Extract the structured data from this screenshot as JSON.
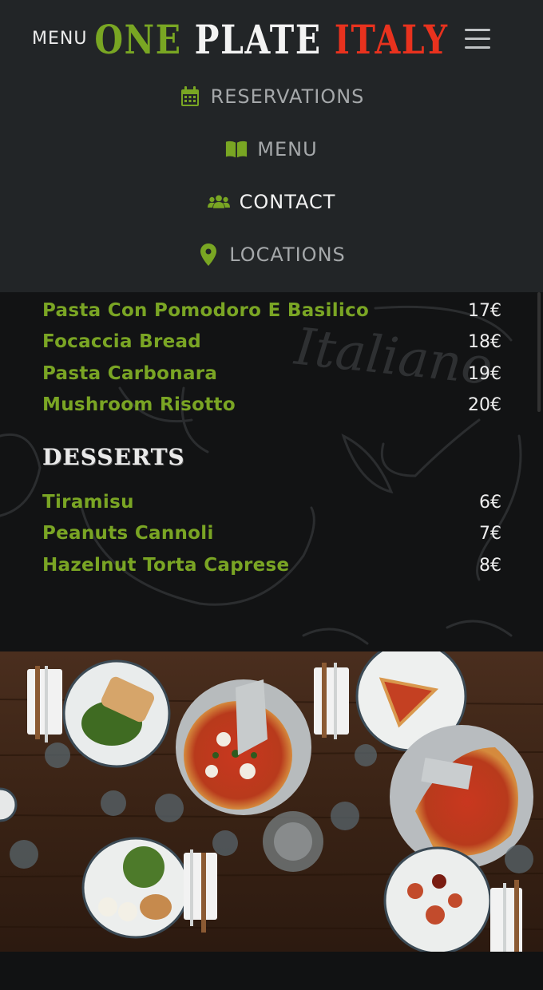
{
  "header": {
    "menu_label": "MENU",
    "logo": {
      "word1": "ONE",
      "word2": "PLATE",
      "word3": "ITALY"
    },
    "colors": {
      "green": "#79a623",
      "white": "#f3f3f3",
      "red": "#e8321e"
    }
  },
  "nav": {
    "items": [
      {
        "label": "RESERVATIONS",
        "icon": "calendar-icon"
      },
      {
        "label": "MENU",
        "icon": "book-icon"
      },
      {
        "label": "CONTACT",
        "icon": "users-icon",
        "active": true
      },
      {
        "label": "LOCATIONS",
        "icon": "map-pin-icon"
      }
    ]
  },
  "mains": [
    {
      "name": "Pasta Con Pomodoro E Basilico",
      "price": "17€"
    },
    {
      "name": "Focaccia Bread",
      "price": "18€"
    },
    {
      "name": "Pasta Carbonara",
      "price": "19€"
    },
    {
      "name": "Mushroom Risotto",
      "price": "20€"
    }
  ],
  "desserts": {
    "title": "DESSERTS",
    "items": [
      {
        "name": "Tiramisu",
        "price": "6€"
      },
      {
        "name": "Peanuts Cannoli",
        "price": "7€"
      },
      {
        "name": "Hazelnut Torta Caprese",
        "price": "8€"
      }
    ]
  },
  "background_text": "Italiano"
}
